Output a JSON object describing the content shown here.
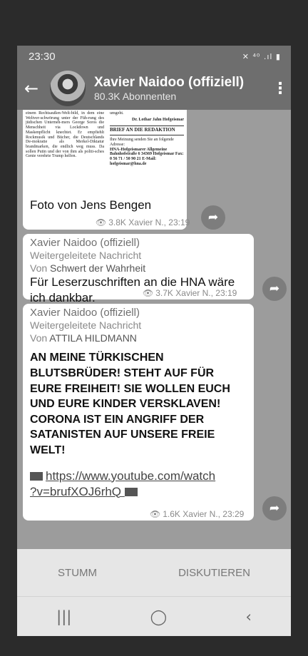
{
  "status": {
    "time": "23:30",
    "icons": "✕ ⁴⁰ .ıl ▮"
  },
  "header": {
    "channel_name": "Xavier Naidoo (offiziell)",
    "subscribers": "80.3K Abonnenten"
  },
  "clipping": {
    "left_text": "einem Rechtsaußen-Welt-bild, in dem eine Weltver-schwörung unter der Füh-rung des jüdischen Unterneh-mers George Soros die Menschheit via Lockdown und Maskenpflicht knechtet. Er empfiehlt Rockmusik und Bücher, die Deutschlands De-mokratie als Merkel-Diktatur brandmarken, die endlich weg muss. Da sollen Putin und der von ihm als politi-sches Genie verehrte Trump helfen.",
    "right_top": "umgeht.",
    "signature": "Dr. Lothar Jahn Hofgeismar",
    "heading": "BRIEF AN DIE REDAKTION",
    "intro": "Ihre Meinung senden Sie an folgende Adresse:",
    "address": "HNA-Hofgeismarer Allgemeine Bahnhofstraße 6 34369 Hofgeismar Fax: 0 56 71 / 50 90 21 E-Mail: hofgeismar@hna.de"
  },
  "messages": [
    {
      "caption": "Foto von Jens Bengen",
      "views": "3.8K",
      "meta": "Xavier N., 23:19"
    },
    {
      "author": "Xavier Naidoo (offiziell)",
      "forwarded": "Weitergeleitete Nachricht",
      "from_prefix": "Von",
      "from": "Schwert der Wahrheit",
      "text": "Für Leserzuschriften an die HNA wäre ich dankbar.",
      "views": "3.7K",
      "meta": "Xavier N., 23:19"
    },
    {
      "author": "Xavier Naidoo (offiziell)",
      "forwarded": "Weitergeleitete Nachricht",
      "from_prefix": "Von",
      "from": "ATTILA HILDMANN",
      "text": "AN MEINE TÜRKISCHEN BLUTSBRÜDER! STEHT AUF FÜR EURE FREIHEIT! SIE WOLLEN EUCH UND EURE KINDER VERSKLAVEN! CORONA IST EIN ANGRIFF DER SATANISTEN AUF UNSERE FREIE WELT!",
      "link_line1": "https://www.youtube.com/watch",
      "link_line2": "?v=brufXOJ6rhQ",
      "views": "1.6K",
      "meta": "Xavier N., 23:29"
    }
  ],
  "bottombar": {
    "mute": "STUMM",
    "discuss": "DISKUTIEREN"
  },
  "nav": {
    "recent": "|||",
    "home": "◯",
    "back": "‹"
  }
}
